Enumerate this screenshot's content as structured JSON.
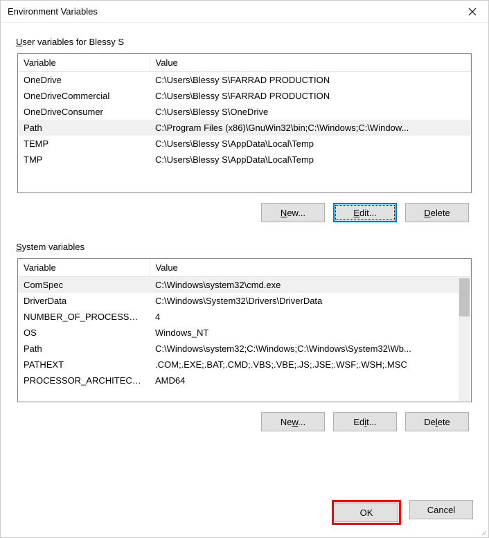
{
  "title": "Environment Variables",
  "user_section": {
    "label_prefix": "U",
    "label_rest": "ser variables for Blessy S",
    "headers": {
      "var": "Variable",
      "val": "Value"
    },
    "rows": [
      {
        "var": "OneDrive",
        "val": "C:\\Users\\Blessy S\\FARRAD PRODUCTION"
      },
      {
        "var": "OneDriveCommercial",
        "val": "C:\\Users\\Blessy S\\FARRAD PRODUCTION"
      },
      {
        "var": "OneDriveConsumer",
        "val": "C:\\Users\\Blessy S\\OneDrive"
      },
      {
        "var": "Path",
        "val": "C:\\Program Files (x86)\\GnuWin32\\bin;C:\\Windows;C:\\Window..."
      },
      {
        "var": "TEMP",
        "val": "C:\\Users\\Blessy S\\AppData\\Local\\Temp"
      },
      {
        "var": "TMP",
        "val": "C:\\Users\\Blessy S\\AppData\\Local\\Temp"
      }
    ],
    "selected_index": 3,
    "buttons": {
      "new_u": "N",
      "new_r": "ew...",
      "edit_u": "E",
      "edit_r": "dit...",
      "del_u": "D",
      "del_r": "elete"
    }
  },
  "system_section": {
    "label_prefix": "S",
    "label_rest": "ystem variables",
    "headers": {
      "var": "Variable",
      "val": "Value"
    },
    "rows": [
      {
        "var": "ComSpec",
        "val": "C:\\Windows\\system32\\cmd.exe"
      },
      {
        "var": "DriverData",
        "val": "C:\\Windows\\System32\\Drivers\\DriverData"
      },
      {
        "var": "NUMBER_OF_PROCESSORS",
        "val": "4"
      },
      {
        "var": "OS",
        "val": "Windows_NT"
      },
      {
        "var": "Path",
        "val": "C:\\Windows\\system32;C:\\Windows;C:\\Windows\\System32\\Wb..."
      },
      {
        "var": "PATHEXT",
        "val": ".COM;.EXE;.BAT;.CMD;.VBS;.VBE;.JS;.JSE;.WSF;.WSH;.MSC"
      },
      {
        "var": "PROCESSOR_ARCHITECTU...",
        "val": "AMD64"
      }
    ],
    "selected_index": 0,
    "buttons": {
      "new_u": "w",
      "new_r_pre": "Ne",
      "new_r_post": "...",
      "edit_u": "i",
      "edit_r_pre": "Ed",
      "edit_r_post": "t...",
      "del_u": "l",
      "del_r_pre": "De",
      "del_r_post": "ete"
    }
  },
  "footer": {
    "ok": "OK",
    "cancel": "Cancel"
  }
}
